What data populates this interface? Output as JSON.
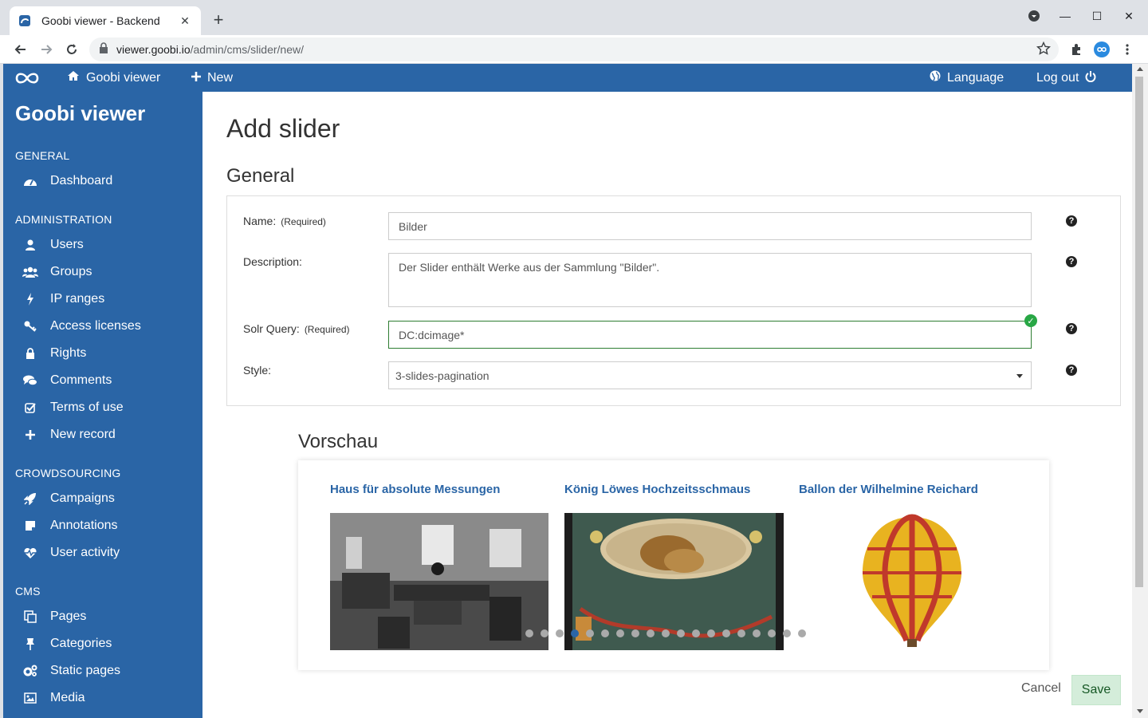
{
  "browser": {
    "tab_title": "Goobi viewer - Backend",
    "url_domain": "viewer.goobi.io",
    "url_path": "/admin/cms/slider/new/"
  },
  "topnav": {
    "home_label": "Goobi viewer",
    "new_label": "New",
    "language_label": "Language",
    "logout_label": "Log out"
  },
  "sidebar": {
    "brand": "Goobi viewer",
    "sections": [
      {
        "title": "GENERAL",
        "items": [
          {
            "label": "Dashboard",
            "icon": "dashboard-icon"
          }
        ]
      },
      {
        "title": "ADMINISTRATION",
        "items": [
          {
            "label": "Users",
            "icon": "user-icon"
          },
          {
            "label": "Groups",
            "icon": "users-icon"
          },
          {
            "label": "IP ranges",
            "icon": "bolt-icon"
          },
          {
            "label": "Access licenses",
            "icon": "key-icon"
          },
          {
            "label": "Rights",
            "icon": "lock-icon"
          },
          {
            "label": "Comments",
            "icon": "comments-icon"
          },
          {
            "label": "Terms of use",
            "icon": "check-square-icon"
          },
          {
            "label": "New record",
            "icon": "plus-icon"
          }
        ]
      },
      {
        "title": "CROWDSOURCING",
        "items": [
          {
            "label": "Campaigns",
            "icon": "rocket-icon"
          },
          {
            "label": "Annotations",
            "icon": "sticky-note-icon"
          },
          {
            "label": "User activity",
            "icon": "heartbeat-icon"
          }
        ]
      },
      {
        "title": "CMS",
        "items": [
          {
            "label": "Pages",
            "icon": "pages-icon"
          },
          {
            "label": "Categories",
            "icon": "pin-icon"
          },
          {
            "label": "Static pages",
            "icon": "cogs-icon"
          },
          {
            "label": "Media",
            "icon": "image-icon"
          }
        ]
      }
    ]
  },
  "main": {
    "title": "Add slider",
    "section_title": "General",
    "form": {
      "name_label": "Name:",
      "name_required": "(Required)",
      "name_value": "Bilder",
      "description_label": "Description:",
      "description_value": "Der Slider enthält Werke aus der Sammlung \"Bilder\".",
      "solr_label": "Solr Query:",
      "solr_required": "(Required)",
      "solr_value": "DC:dcimage*",
      "style_label": "Style:",
      "style_value": "3-slides-pagination",
      "help_glyph": "?"
    },
    "preview": {
      "title": "Vorschau",
      "slides": [
        {
          "title": "Haus für absolute Messungen"
        },
        {
          "title": "König Löwes Hochzeitsschmaus"
        },
        {
          "title": "Ballon der Wilhelmine Reichard"
        }
      ],
      "pagination_count": 19,
      "active_page": 4
    },
    "cancel_label": "Cancel",
    "save_label": "Save"
  },
  "colors": {
    "primary": "#2a65a6",
    "valid": "#28a745",
    "save_bg": "#d4edda"
  }
}
